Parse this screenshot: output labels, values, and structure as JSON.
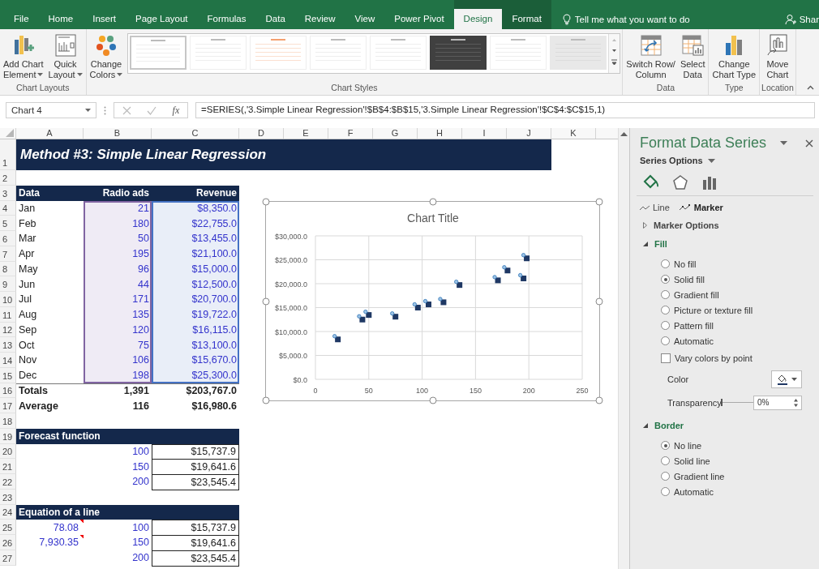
{
  "ribbon_tabs": [
    {
      "label": "File",
      "selected": false,
      "contextual": false
    },
    {
      "label": "Home",
      "selected": false,
      "contextual": false
    },
    {
      "label": "Insert",
      "selected": false,
      "contextual": false
    },
    {
      "label": "Page Layout",
      "selected": false,
      "contextual": false
    },
    {
      "label": "Formulas",
      "selected": false,
      "contextual": false
    },
    {
      "label": "Data",
      "selected": false,
      "contextual": false
    },
    {
      "label": "Review",
      "selected": false,
      "contextual": false
    },
    {
      "label": "View",
      "selected": false,
      "contextual": false
    },
    {
      "label": "Power Pivot",
      "selected": false,
      "contextual": false
    },
    {
      "label": "Design",
      "selected": true,
      "contextual": true
    },
    {
      "label": "Format",
      "selected": false,
      "contextual": true
    }
  ],
  "tell_me": "Tell me what you want to do",
  "share": "Shar",
  "ribbon_groups": [
    {
      "label": "Chart Layouts",
      "buttons": [
        {
          "kind": "add-element",
          "lines": [
            "Add Chart",
            "Element"
          ],
          "dropdown": true
        },
        {
          "kind": "quick-layout",
          "lines": [
            "Quick",
            "Layout"
          ],
          "dropdown": true
        }
      ]
    },
    {
      "label": "Chart Styles",
      "buttons": [
        {
          "kind": "change-colors",
          "lines": [
            "Change",
            "Colors"
          ],
          "dropdown": true
        }
      ],
      "gallery": [
        {
          "kind": "light",
          "selected": true
        },
        {
          "kind": "light",
          "selected": false
        },
        {
          "kind": "accent",
          "selected": false
        },
        {
          "kind": "light",
          "selected": false
        },
        {
          "kind": "light",
          "selected": false
        },
        {
          "kind": "dark",
          "selected": false
        },
        {
          "kind": "light",
          "selected": false
        },
        {
          "kind": "gray",
          "selected": false
        }
      ]
    },
    {
      "label": "Data",
      "buttons": [
        {
          "kind": "switch",
          "lines": [
            "Switch Row/",
            "Column"
          ],
          "dropdown": false
        },
        {
          "kind": "select-data",
          "lines": [
            "Select",
            "Data"
          ],
          "dropdown": false
        }
      ]
    },
    {
      "label": "Type",
      "buttons": [
        {
          "kind": "chart-type",
          "lines": [
            "Change",
            "Chart Type"
          ],
          "dropdown": false
        }
      ]
    },
    {
      "label": "Location",
      "buttons": [
        {
          "kind": "move",
          "lines": [
            "Move",
            "Chart"
          ],
          "dropdown": false
        }
      ]
    }
  ],
  "formula_bar": {
    "name_box": "Chart 4",
    "fx": "fx",
    "formula": "=SERIES(,'3.Simple Linear Regression'!$B$4:$B$15,'3.Simple Linear Regression'!$C$4:$C$15,1)"
  },
  "columns": [
    "A",
    "B",
    "C",
    "D",
    "E",
    "F",
    "G",
    "H",
    "I",
    "J",
    "K"
  ],
  "rows": [
    {
      "num": "1",
      "kind": "title",
      "cells": {
        "a": "Method #3: Simple Linear Regression"
      }
    },
    {
      "num": "2",
      "kind": "blank",
      "cells": {}
    },
    {
      "num": "3",
      "kind": "header",
      "cells": {
        "a": "Data",
        "b": "Radio ads",
        "c": "Revenue"
      }
    },
    {
      "num": "4",
      "kind": "data",
      "cells": {
        "a": "Jan",
        "b": "21",
        "c": "$8,350.0"
      }
    },
    {
      "num": "5",
      "kind": "data",
      "cells": {
        "a": "Feb",
        "b": "180",
        "c": "$22,755.0"
      }
    },
    {
      "num": "6",
      "kind": "data",
      "cells": {
        "a": "Mar",
        "b": "50",
        "c": "$13,455.0"
      }
    },
    {
      "num": "7",
      "kind": "data",
      "cells": {
        "a": "Apr",
        "b": "195",
        "c": "$21,100.0"
      }
    },
    {
      "num": "8",
      "kind": "data",
      "cells": {
        "a": "May",
        "b": "96",
        "c": "$15,000.0"
      }
    },
    {
      "num": "9",
      "kind": "data",
      "cells": {
        "a": "Jun",
        "b": "44",
        "c": "$12,500.0"
      }
    },
    {
      "num": "10",
      "kind": "data",
      "cells": {
        "a": "Jul",
        "b": "171",
        "c": "$20,700.0"
      }
    },
    {
      "num": "11",
      "kind": "data",
      "cells": {
        "a": "Aug",
        "b": "135",
        "c": "$19,722.0"
      }
    },
    {
      "num": "12",
      "kind": "data",
      "cells": {
        "a": "Sep",
        "b": "120",
        "c": "$16,115.0"
      }
    },
    {
      "num": "13",
      "kind": "data",
      "cells": {
        "a": "Oct",
        "b": "75",
        "c": "$13,100.0"
      }
    },
    {
      "num": "14",
      "kind": "data",
      "cells": {
        "a": "Nov",
        "b": "106",
        "c": "$15,670.0"
      }
    },
    {
      "num": "15",
      "kind": "data",
      "cells": {
        "a": "Dec",
        "b": "198",
        "c": "$25,300.0"
      }
    },
    {
      "num": "16",
      "kind": "total",
      "cells": {
        "a": "Totals",
        "b": "1,391",
        "c": "$203,767.0"
      }
    },
    {
      "num": "17",
      "kind": "total",
      "cells": {
        "a": "Average",
        "b": "116",
        "c": "$16,980.6"
      }
    },
    {
      "num": "18",
      "kind": "blank",
      "cells": {}
    },
    {
      "num": "19",
      "kind": "section",
      "cells": {
        "a": "Forecast function"
      }
    },
    {
      "num": "20",
      "kind": "result",
      "cells": {
        "b": "100",
        "c": "$15,737.9"
      }
    },
    {
      "num": "21",
      "kind": "result",
      "cells": {
        "b": "150",
        "c": "$19,641.6"
      }
    },
    {
      "num": "22",
      "kind": "result",
      "cells": {
        "b": "200",
        "c": "$23,545.4"
      }
    },
    {
      "num": "23",
      "kind": "blank",
      "cells": {}
    },
    {
      "num": "24",
      "kind": "section",
      "cells": {
        "a": "Equation of a line"
      }
    },
    {
      "num": "25",
      "kind": "result",
      "comment": true,
      "cells": {
        "a": "78.08",
        "b": "100",
        "c": "$15,737.9"
      }
    },
    {
      "num": "26",
      "kind": "result",
      "comment": true,
      "cells": {
        "a": "7,930.35",
        "b": "150",
        "c": "$19,641.6"
      }
    },
    {
      "num": "27",
      "kind": "result",
      "cells": {
        "b": "200",
        "c": "$23,545.4"
      }
    }
  ],
  "chart": {
    "selected": true,
    "chart_data": {
      "type": "scatter",
      "title": "Chart Title",
      "x": [
        21,
        180,
        50,
        195,
        96,
        44,
        171,
        135,
        120,
        75,
        106,
        198
      ],
      "series": [
        {
          "color": "#1f3864",
          "values": [
            8350,
            22755,
            13455,
            21100,
            15000,
            12500,
            20700,
            19722,
            16115,
            13100,
            15670,
            25300
          ]
        }
      ],
      "xlim": [
        0,
        250
      ],
      "ylim": [
        0,
        30000
      ],
      "grid": true,
      "xticks": [
        0,
        50,
        100,
        150,
        200,
        250
      ],
      "yticks": [
        {
          "value": 0,
          "label": "$0.0"
        },
        {
          "value": 5000,
          "label": "$5,000.0"
        },
        {
          "value": 10000,
          "label": "$10,000.0"
        },
        {
          "value": 15000,
          "label": "$15,000.0"
        },
        {
          "value": 20000,
          "label": "$20,000.0"
        },
        {
          "value": 25000,
          "label": "$25,000.0"
        },
        {
          "value": 30000,
          "label": "$30,000.0"
        }
      ]
    }
  },
  "pane": {
    "title": "Format Data Series",
    "subtitle": "Series Options",
    "icon_tabs": [
      {
        "kind": "fill",
        "selected": true
      },
      {
        "kind": "effects",
        "selected": false
      },
      {
        "kind": "series",
        "selected": false
      }
    ],
    "subtabs": [
      {
        "label": "Line",
        "selected": false
      },
      {
        "label": "Marker",
        "selected": true
      }
    ],
    "sections": [
      {
        "title": "Marker Options",
        "expanded": false
      },
      {
        "title": "Fill",
        "expanded": true,
        "options": [
          {
            "label": "No fill",
            "selected": false
          },
          {
            "label": "Solid fill",
            "selected": true
          },
          {
            "label": "Gradient fill",
            "selected": false
          },
          {
            "label": "Picture or texture fill",
            "selected": false
          },
          {
            "label": "Pattern fill",
            "selected": false
          },
          {
            "label": "Automatic",
            "selected": false
          }
        ],
        "checkbox": {
          "label": "Vary colors by point",
          "checked": false
        },
        "color_label": "Color",
        "transparency": {
          "label": "Transparency",
          "level": 0,
          "value": "0%"
        }
      },
      {
        "title": "Border",
        "expanded": true,
        "options": [
          {
            "label": "No line",
            "selected": true
          },
          {
            "label": "Solid line",
            "selected": false
          },
          {
            "label": "Gradient line",
            "selected": false
          },
          {
            "label": "Automatic",
            "selected": false
          }
        ]
      }
    ]
  }
}
